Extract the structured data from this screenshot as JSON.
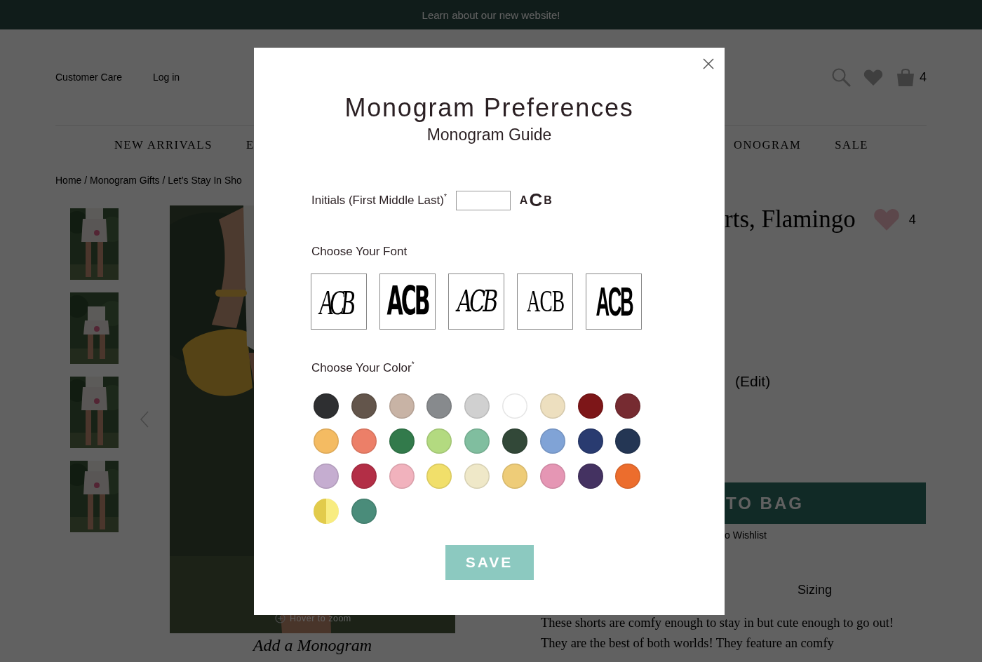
{
  "announcement": "Learn about our new website!",
  "header": {
    "links": [
      "Customer Care",
      "Log in"
    ],
    "bag_count": "4"
  },
  "nav": {
    "left": [
      "NEW ARRIVALS",
      "E"
    ],
    "right": [
      "ONOGRAM",
      "SALE"
    ]
  },
  "breadcrumb": "Home / Monogram Gifts / Let’s Stay In Sho",
  "gallery": {
    "hover_hint": "Hover to zoom",
    "caption": "Add a Monogram"
  },
  "product": {
    "title": "rts, Flamingo",
    "wishlist_count": "4",
    "edit_link": "(Edit)",
    "add_button": "TO BAG",
    "wishlist_link": "o Wishlist",
    "tab": "Sizing",
    "description": "These shorts are comfy enough to stay in but cute enough to go out! They are the best of both worlds! They feature an comfy"
  },
  "modal": {
    "title": "Monogram Preferences",
    "subtitle": "Monogram Guide",
    "initials_label": "Initials (First Middle Last)$^{*}$",
    "preview": [
      "A",
      "C",
      "B"
    ],
    "font_label": "Choose Your Font",
    "fonts": [
      {
        "kind": "vine",
        "sample": "ACB"
      },
      {
        "kind": "circle",
        "sample": "ACB"
      },
      {
        "kind": "script",
        "sample": "ACB"
      },
      {
        "kind": "block",
        "sample": "ACB"
      },
      {
        "kind": "diamond",
        "sample": "ACB"
      }
    ],
    "color_label": "Choose Your Color$^{*}$",
    "colors": [
      {
        "kind": "solid",
        "color": "#2e2f31"
      },
      {
        "kind": "solid",
        "color": "#63554b"
      },
      {
        "kind": "solid",
        "color": "#c8b3a5"
      },
      {
        "kind": "solid",
        "color": "#878a8d"
      },
      {
        "kind": "solid",
        "color": "#d0d0d0"
      },
      {
        "kind": "solid",
        "color": "#ffffff"
      },
      {
        "kind": "solid",
        "color": "#eddfbf"
      },
      {
        "kind": "solid",
        "color": "#7d1618"
      },
      {
        "kind": "solid",
        "color": "#762b31"
      },
      {
        "kind": "solid",
        "color": "#f4bb62"
      },
      {
        "kind": "solid",
        "color": "#ec7f68"
      },
      {
        "kind": "solid",
        "color": "#327a4b"
      },
      {
        "kind": "solid",
        "color": "#b3da80"
      },
      {
        "kind": "solid",
        "color": "#80be9f"
      },
      {
        "kind": "solid",
        "color": "#324838"
      },
      {
        "kind": "solid",
        "color": "#80a3d6"
      },
      {
        "kind": "solid",
        "color": "#293b70"
      },
      {
        "kind": "solid",
        "color": "#243654"
      },
      {
        "kind": "solid",
        "color": "#c5add0"
      },
      {
        "kind": "solid",
        "color": "#b32e46"
      },
      {
        "kind": "solid",
        "color": "#f1b2bd"
      },
      {
        "kind": "solid",
        "color": "#f1df6a"
      },
      {
        "kind": "solid",
        "color": "#efe8c8"
      },
      {
        "kind": "solid",
        "color": "#eecc78"
      },
      {
        "kind": "solid",
        "color": "#e596b4"
      },
      {
        "kind": "solid",
        "color": "#443261"
      },
      {
        "kind": "solid",
        "color": "#ec6d2d"
      },
      {
        "kind": "split",
        "halves": [
          {
            "color": "#e2cb4b"
          },
          {
            "color": "#f8ec80"
          }
        ]
      },
      {
        "kind": "solid",
        "color": "#4a8c7a"
      }
    ],
    "save_button": "SAVE"
  }
}
